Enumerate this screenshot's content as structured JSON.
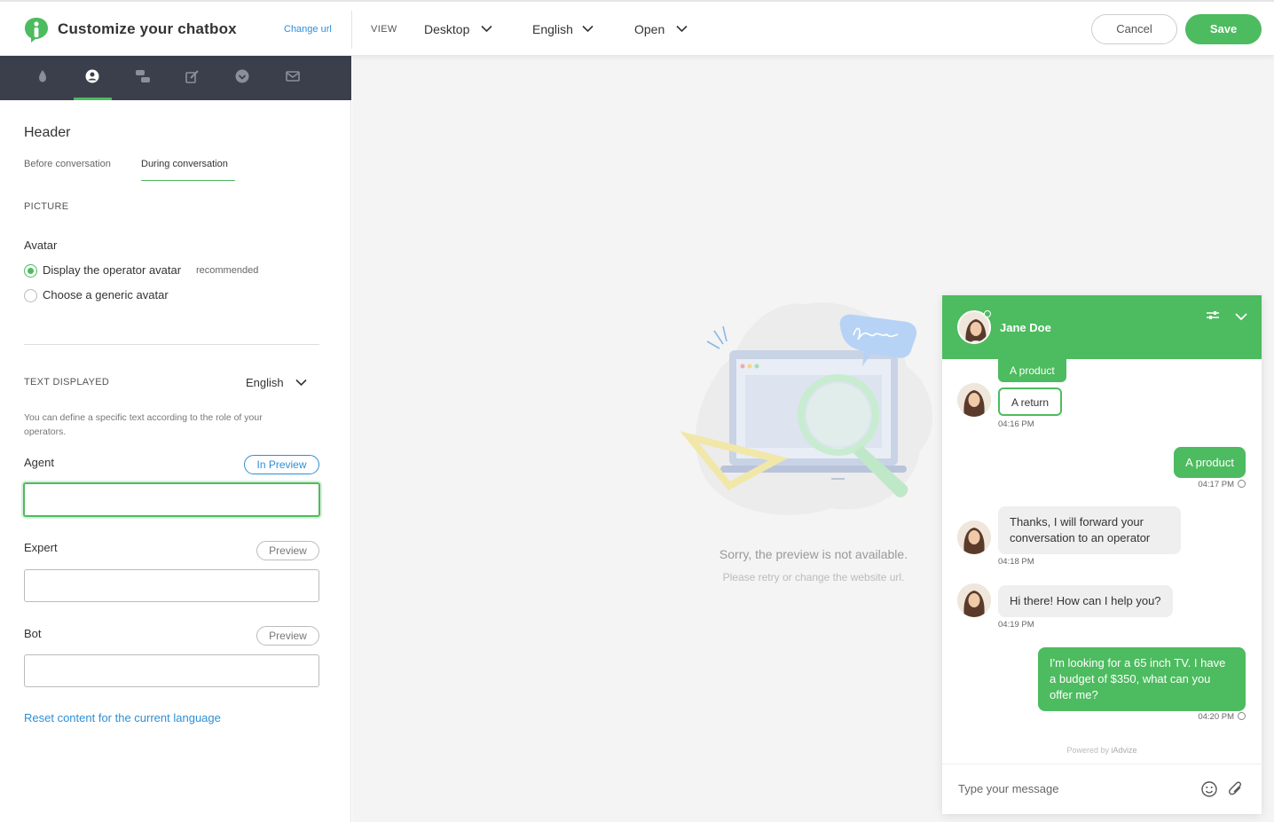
{
  "header": {
    "title": "Customize your chatbox",
    "change_url": "Change url",
    "view_label": "VIEW",
    "device": "Desktop",
    "language": "English",
    "state": "Open",
    "cancel": "Cancel",
    "save": "Save"
  },
  "sidebar": {
    "tab_icons": [
      "drop-icon",
      "user-icon",
      "conversation-icon",
      "edit-icon",
      "check-circle-icon",
      "mail-icon"
    ],
    "active_tab": 1,
    "section_title": "Header",
    "subtabs": [
      "Before conversation",
      "During conversation"
    ],
    "picture_label": "PICTURE",
    "avatar_label": "Avatar",
    "avatar_options": [
      {
        "label": "Display the operator avatar",
        "tag": "recommended",
        "selected": true
      },
      {
        "label": "Choose a generic avatar",
        "selected": false
      }
    ],
    "text_displayed_label": "TEXT DISPLAYED",
    "text_language": "English",
    "note": "You can define a specific text according to the role of your operators.",
    "fields": [
      {
        "label": "Agent",
        "badge": "In Preview",
        "value": ""
      },
      {
        "label": "Expert",
        "badge": "Preview",
        "value": ""
      },
      {
        "label": "Bot",
        "badge": "Preview",
        "value": ""
      }
    ],
    "reset_link": "Reset content for the current language"
  },
  "preview": {
    "unavailable_title": "Sorry, the preview is not available.",
    "unavailable_sub": "Please retry or change the website url."
  },
  "chat": {
    "operator_name": "Jane Doe",
    "accent": "#4dbb5f",
    "quick_reply_selected": "A product",
    "quick_reply_option": "A return",
    "ts1": "04:16 PM",
    "visitor_msg1": "A product",
    "ts2": "04:17 PM",
    "op_msg1": "Thanks, I will forward your conversation to an operator",
    "ts3": "04:18 PM",
    "op_msg2": "Hi there! How can I help you?",
    "ts4": "04:19 PM",
    "visitor_msg2": "I'm looking for a 65 inch TV. I have a budget of $350, what can you offer me?",
    "ts5": "04:20 PM",
    "powered_by": "Powered by",
    "brand": "iAdvize",
    "input_placeholder": "Type your message"
  }
}
